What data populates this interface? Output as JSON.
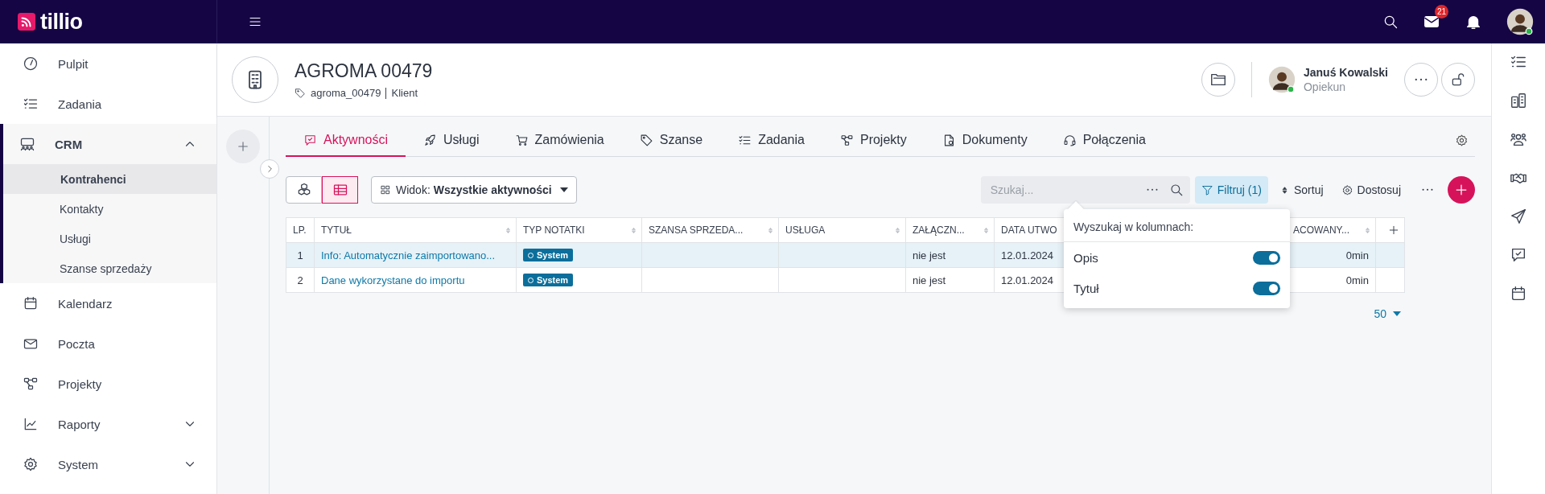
{
  "topbar": {
    "logo": "tillio",
    "mail_badge": "21"
  },
  "sidebar": {
    "items": [
      {
        "label": "Pulpit",
        "kind": "link",
        "selected": false
      },
      {
        "label": "Zadania",
        "kind": "link",
        "selected": false
      },
      {
        "label": "CRM",
        "kind": "group",
        "selected": true,
        "expanded": true,
        "children": [
          {
            "label": "Kontrahenci",
            "selected": true
          },
          {
            "label": "Kontakty",
            "selected": false
          },
          {
            "label": "Usługi",
            "selected": false
          },
          {
            "label": "Szanse sprzedaży",
            "selected": false
          }
        ]
      },
      {
        "label": "Kalendarz",
        "kind": "link",
        "selected": false
      },
      {
        "label": "Poczta",
        "kind": "link",
        "selected": false
      },
      {
        "label": "Projekty",
        "kind": "link",
        "selected": false
      },
      {
        "label": "Raporty",
        "kind": "group",
        "selected": false,
        "expanded": false
      },
      {
        "label": "System",
        "kind": "group",
        "selected": false,
        "expanded": false
      }
    ]
  },
  "record": {
    "title": "AGROMA 00479",
    "tag": "agroma_00479",
    "type": "Klient",
    "owner_name": "Januś Kowalski",
    "owner_role": "Opiekun"
  },
  "tabs": [
    {
      "label": "Aktywności",
      "selected": true
    },
    {
      "label": "Usługi",
      "selected": false
    },
    {
      "label": "Zamówienia",
      "selected": false
    },
    {
      "label": "Szanse",
      "selected": false
    },
    {
      "label": "Zadania",
      "selected": false
    },
    {
      "label": "Projekty",
      "selected": false
    },
    {
      "label": "Dokumenty",
      "selected": false
    },
    {
      "label": "Połączenia",
      "selected": false
    }
  ],
  "toolbar": {
    "view_modes": [
      {
        "selected": false
      },
      {
        "selected": true
      }
    ],
    "view_label": "Widok:",
    "view_value": "Wszystkie aktywności",
    "search": {
      "placeholder": "Szukaj..."
    },
    "filter": {
      "label": "Filtruj (1)",
      "selected": true
    },
    "sort": "Sortuj",
    "customize": "Dostosuj"
  },
  "table": {
    "columns": [
      {
        "label": "LP.",
        "sortable": false
      },
      {
        "label": "TYTUŁ",
        "sortable": true
      },
      {
        "label": "TYP NOTATKI",
        "sortable": true
      },
      {
        "label": "SZANSA SPRZEDA...",
        "sortable": true
      },
      {
        "label": "USŁUGA",
        "sortable": true
      },
      {
        "label": "ZAŁĄCZN...",
        "sortable": true
      },
      {
        "label": "DATA UTWO",
        "sortable": false
      },
      {
        "label": "ACOWANY...",
        "sortable": true
      }
    ],
    "rows": [
      {
        "lp": "1",
        "title": "Info: Automatycznie zaimportowano...",
        "type": "System",
        "attachment": "nie jest",
        "date": "12.01.2024",
        "time": "0min",
        "selected": true
      },
      {
        "lp": "2",
        "title": "Dane wykorzystane do importu",
        "type": "System",
        "attachment": "nie jest",
        "date": "12.01.2024",
        "time": "0min",
        "selected": false
      }
    ],
    "page_size": "50"
  },
  "search_popup": {
    "title": "Wyszukaj w kolumnach:",
    "options": [
      {
        "label": "Opis",
        "on": true
      },
      {
        "label": "Tytuł",
        "on": true
      }
    ]
  }
}
